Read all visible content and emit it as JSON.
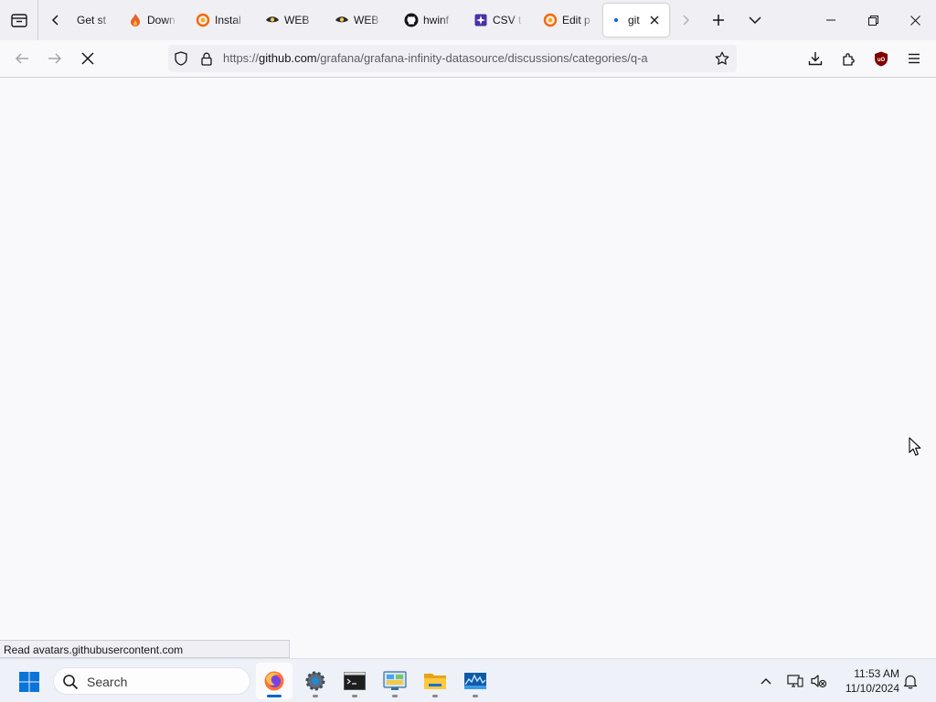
{
  "browser": {
    "tabs": [
      {
        "label": "Get st",
        "favicon": "firefox-page-icon"
      },
      {
        "label": "Down",
        "favicon": "flame-icon"
      },
      {
        "label": "Instal",
        "favicon": "grafana-icon"
      },
      {
        "label": "WEB",
        "favicon": "eye-icon"
      },
      {
        "label": "WEB",
        "favicon": "eye-icon"
      },
      {
        "label": "hwinf",
        "favicon": "github-icon"
      },
      {
        "label": "CSV t",
        "favicon": "csv-icon"
      },
      {
        "label": "Edit p",
        "favicon": "grafana-icon"
      },
      {
        "label": "git",
        "favicon": "loading-dot-icon",
        "active": true
      }
    ],
    "url": {
      "scheme": "https://",
      "host": "github.com",
      "path": "/grafana/grafana-infinity-datasource/discussions/categories/q-a"
    },
    "status_tip": "Read avatars.githubusercontent.com",
    "accent": "#0060df",
    "ublock_color": "#800000"
  },
  "taskbar": {
    "search_placeholder": "Search",
    "apps": [
      "firefox",
      "settings",
      "terminal",
      "control-panel",
      "file-explorer",
      "monitor"
    ],
    "clock_time": "11:53 AM",
    "clock_date": "11/10/2024"
  }
}
